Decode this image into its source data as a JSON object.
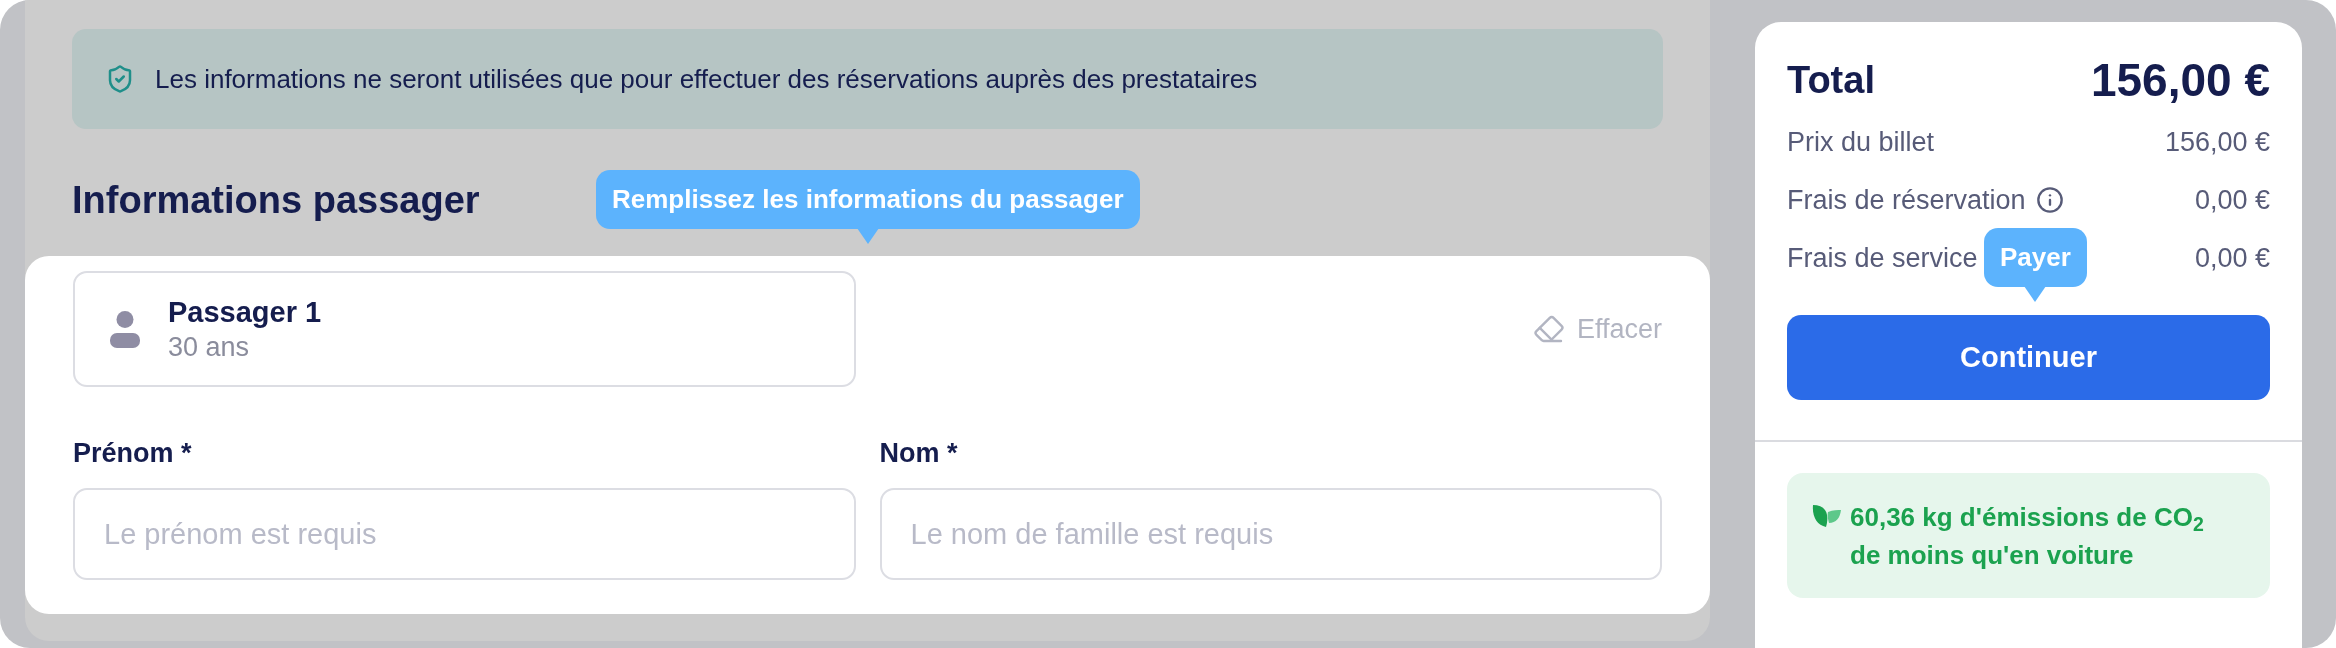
{
  "notice": {
    "text": "Les informations ne seront utilisées que pour effectuer des réservations auprès des prestataires"
  },
  "passenger_section": {
    "title": "Informations passager",
    "tooltip": "Remplissez les informations du passager",
    "passenger": {
      "name": "Passager 1",
      "age": "30 ans"
    },
    "clear_button": "Effacer",
    "fields": [
      {
        "label": "Prénom *",
        "placeholder": "Le prénom est requis"
      },
      {
        "label": "Nom *",
        "placeholder": "Le nom de famille est requis"
      }
    ]
  },
  "summary": {
    "total_label": "Total",
    "total_value": "156,00 €",
    "lines": [
      {
        "label": "Prix du billet",
        "value": "156,00 €",
        "info": false
      },
      {
        "label": "Frais de réservation",
        "value": "0,00 €",
        "info": true
      },
      {
        "label": "Frais de service",
        "value": "0,00 €",
        "info": false
      }
    ],
    "tooltip": "Payer",
    "button": "Continuer",
    "emissions": "60,36 kg d'émissions de CO$_{2}$ de moins qu'en voiture"
  }
}
